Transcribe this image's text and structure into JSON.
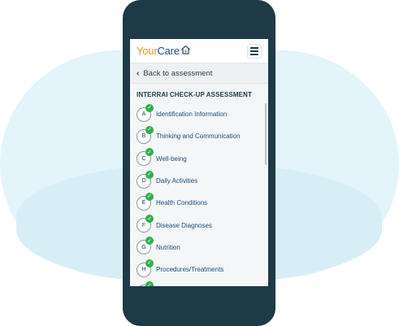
{
  "header": {
    "logo_your": "Your",
    "logo_care": "Care",
    "logo_icon": "house-plus-icon",
    "menu_icon": "hamburger-icon"
  },
  "nav": {
    "back_label": "Back to assessment",
    "back_icon": "chevron-left-icon"
  },
  "assessment": {
    "title": "INTERRAI CHECK-UP ASSESSMENT",
    "sections": [
      {
        "letter": "A",
        "label": "Identification Information",
        "completed": true
      },
      {
        "letter": "B",
        "label": "Thinking and Communication",
        "completed": true
      },
      {
        "letter": "C",
        "label": "Well-being",
        "completed": true
      },
      {
        "letter": "D",
        "label": "Daily Activities",
        "completed": true
      },
      {
        "letter": "E",
        "label": "Health Conditions",
        "completed": true
      },
      {
        "letter": "F",
        "label": "Disease Diagnoses",
        "completed": true
      },
      {
        "letter": "G",
        "label": "Nutrition",
        "completed": true
      },
      {
        "letter": "H",
        "label": "Procedures/Treatments",
        "completed": true
      }
    ]
  },
  "colors": {
    "brand_orange": "#f39221",
    "brand_navy": "#1f4d7a",
    "check_green": "#2db34a",
    "phone_frame": "#1e3a46",
    "background_blob": "#e3f4fb"
  }
}
